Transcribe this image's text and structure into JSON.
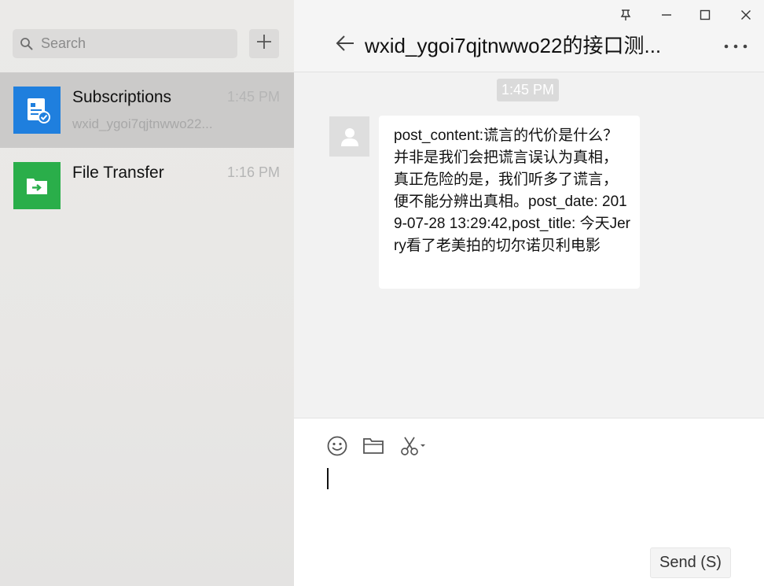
{
  "sidebar": {
    "search_placeholder": "Search",
    "chats": [
      {
        "name": "Subscriptions",
        "time": "1:45 PM",
        "preview": "wxid_ygoi7qjtnwwo22...",
        "avatar_color": "#1f7fde",
        "avatar_icon": "subscriptions-icon",
        "active": true
      },
      {
        "name": "File Transfer",
        "time": "1:16 PM",
        "preview": "",
        "avatar_color": "#2aae4a",
        "avatar_icon": "file-transfer-icon",
        "active": false
      }
    ]
  },
  "chat": {
    "title": "wxid_ygoi7qjtnwwo22的接口测...",
    "time_badge": "1:45 PM",
    "message": "post_content:谎言的代价是什么？并非是我们会把谎言误认为真相，真正危险的是，我们听多了谎言，便不能分辨出真相。post_date: 2019-07-28 13:29:42,post_title: 今天Jerry看了老美拍的切尔诺贝利电影"
  },
  "composer": {
    "tools": [
      "emoji-icon",
      "folder-icon",
      "scissors-icon"
    ],
    "send_label": "Send (S)"
  },
  "window_controls": [
    "pin-icon",
    "minimize-icon",
    "maximize-icon",
    "close-icon"
  ]
}
